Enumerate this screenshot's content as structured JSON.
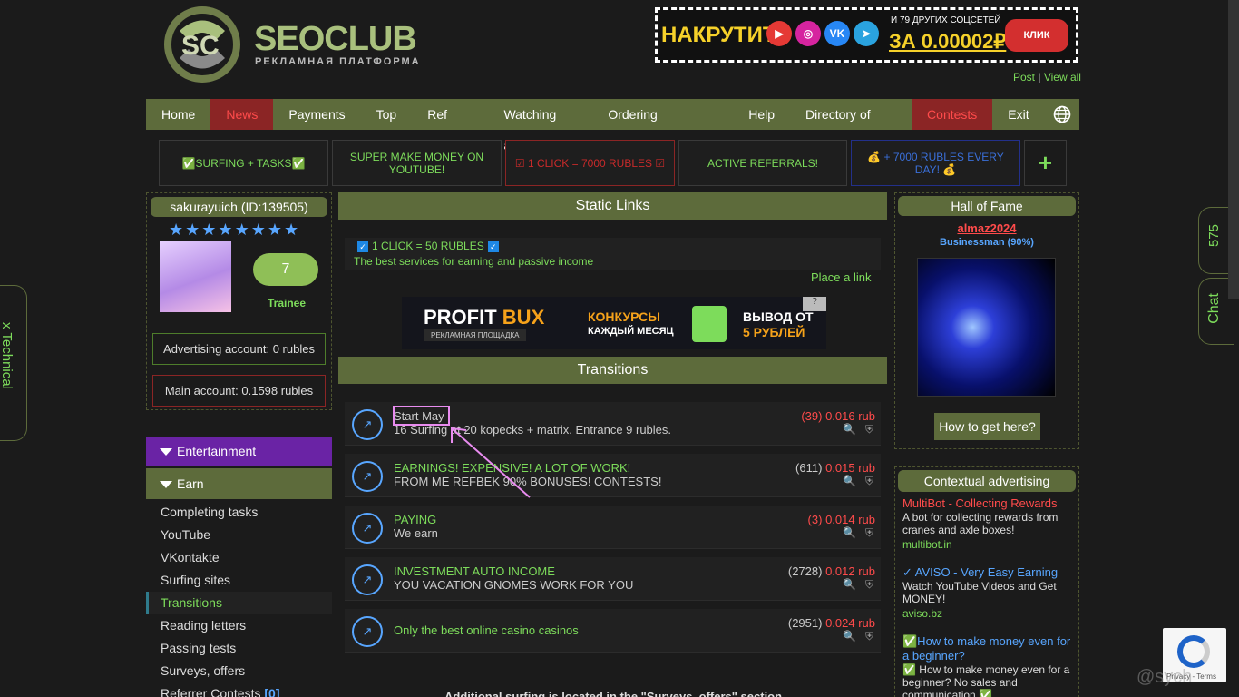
{
  "logo": {
    "word": "SEOCLUB",
    "subtitle": "РЕКЛАМНАЯ ПЛАТФОРМА"
  },
  "top_banner": {
    "left": "НАКРУТИТЬ",
    "small": "И 79 ДРУГИХ СОЦСЕТЕЙ",
    "price": "ЗА 0.00002₽",
    "button": "КЛИК"
  },
  "post_links": {
    "post": "Post",
    "sep": "|",
    "view_all": "View all"
  },
  "nav": [
    "Home",
    "News",
    "Payments",
    "Top",
    "Ref Wall",
    "Watching ads",
    "Ordering advertising",
    "Help",
    "Directory of sites",
    "Contests",
    "Exit"
  ],
  "promos": [
    {
      "text": "✅SURFING + TASKS✅",
      "color": "#7ddc5b",
      "border": "#3a3a3a"
    },
    {
      "text": "SUPER MAKE MONEY ON YOUTUBE!",
      "color": "#7ddc5b",
      "border": "#3a3a3a"
    },
    {
      "text": "☑ 1 CLICK = 7000 RUBLES ☑",
      "color": "#c92a2a",
      "border": "#8b2525"
    },
    {
      "text": "ACTIVE REFERRALS!",
      "color": "#7ddc5b",
      "border": "#3a3a3a"
    },
    {
      "text": "💰 + 7000 RUBLES EVERY DAY! 💰",
      "color": "#3a6fd8",
      "border": "#23308a"
    }
  ],
  "promo_plus": "+",
  "user": {
    "name": "sakurayuich (ID:139505)",
    "stars": "★★★★★★★★",
    "level": "7",
    "rank": "Trainee",
    "ad_account": "Advertising account: 0 rubles",
    "main_account": "Main account: 0.1598 rubles"
  },
  "menu": {
    "entertainment": "Entertainment",
    "earn": "Earn",
    "items": [
      "Completing tasks",
      "YouTube",
      "VKontakte",
      "Surfing sites",
      "Transitions",
      "Reading letters",
      "Passing tests",
      "Surveys, offers"
    ],
    "referrer": "Referrer Contests",
    "referrer_count": "[0]"
  },
  "static": {
    "title": "Static Links",
    "line1": "1 CLICK = 50 RUBLES",
    "line2": "The best services for earning and passive income",
    "place_link": "Place a link"
  },
  "profit_banner": {
    "title_a": "PROFIT",
    "title_b": "BUX",
    "sub": "РЕКЛАМНАЯ ПЛОЩАДКА",
    "konk1": "КОНКУРСЫ",
    "konk2": "КАЖДЫЙ МЕСЯЦ",
    "vyvod1": "ВЫВОД ОТ",
    "vyvod2": "5 РУБЛЕЙ",
    "q": "?"
  },
  "transitions": {
    "title": "Transitions",
    "rows": [
      {
        "t1": "Start May",
        "t2": "16 Surfing at 20 kopecks + matrix. Entrance 9 rubles.",
        "count": "(39)",
        "amount": "0.016 rub",
        "t1color": "#cccccc",
        "countcolor": "#ff4b4b"
      },
      {
        "t1": "EARNINGS! EXPENSIVE! A LOT OF WORK!",
        "t2": "FROM ME REFBEK 90% BONUSES! CONTESTS!",
        "count": "(611)",
        "amount": "0.015 rub",
        "t1color": "#7ddc5b",
        "countcolor": "#cccccc"
      },
      {
        "t1": "PAYING",
        "t2": "We earn",
        "count": "(3)",
        "amount": "0.014 rub",
        "t1color": "#7ddc5b",
        "countcolor": "#ff4b4b"
      },
      {
        "t1": "INVESTMENT AUTO INCOME",
        "t2": "YOU VACATION GNOMES WORK FOR YOU",
        "count": "(2728)",
        "amount": "0.012 rub",
        "t1color": "#7ddc5b",
        "countcolor": "#cccccc"
      },
      {
        "t1": "Only the best online casino casinos",
        "t2": "",
        "count": "(2951)",
        "amount": "0.024 rub",
        "t1color": "#7ddc5b",
        "countcolor": "#cccccc"
      }
    ]
  },
  "bottom_note": "Additional surfing is located in the \"Surveys, offers\" section",
  "hall": {
    "title": "Hall of Fame",
    "name": "almaz2024",
    "status": "Businessman (90%)",
    "button": "How to get here?"
  },
  "context": {
    "title": "Contextual advertising",
    "ads": [
      {
        "title": "MultiBot - Collecting Rewards",
        "desc": "A bot for collecting rewards from cranes and axle boxes!",
        "url": "multibot.in",
        "color": "#ff4b4b"
      },
      {
        "title": "✓ AVISO - Very Easy Earning",
        "desc": "Watch YouTube Videos and Get MONEY!",
        "url": "aviso.bz",
        "color": "#58a6ff"
      },
      {
        "title": "✅How to make money even for a beginner?",
        "desc": "✅ How to make money even for a beginner? No sales and communication ✅",
        "url": "",
        "color": "#58a6ff"
      }
    ]
  },
  "side": {
    "technical": "x Technical",
    "count": "575",
    "chat": "Chat"
  },
  "recaptcha": "Privacy - Terms",
  "watermark": "@sych"
}
